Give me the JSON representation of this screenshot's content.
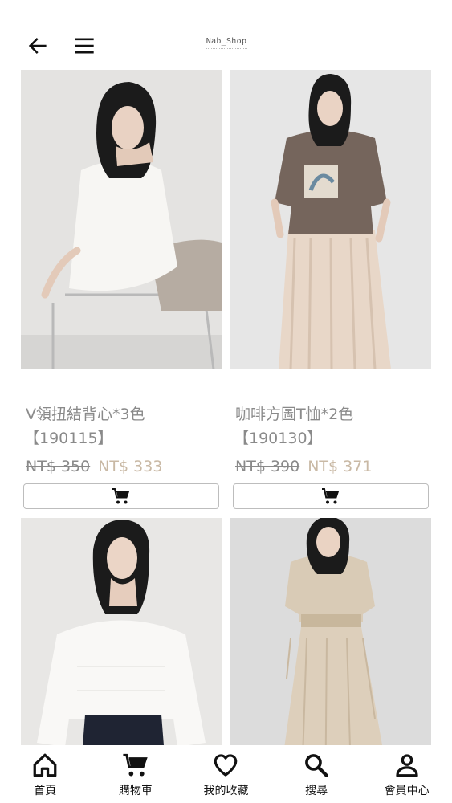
{
  "header": {
    "logo_text": "Nab_Shop",
    "back_icon": "arrow-left-icon",
    "menu_icon": "hamburger-menu-icon"
  },
  "products": [
    {
      "image": "model in white sleeveless top, beige trousers, seated on clear chair",
      "name": "V領扭結背心*3色",
      "code": "【190115】",
      "original_price": "NT$ 350",
      "sale_price": "NT$ 333",
      "cart_icon": "shopping-cart-icon"
    },
    {
      "image": "model in brown graphic tee and pleated beige wide-leg pants",
      "name": "咖啡方圖T恤*2色",
      "code": "【190130】",
      "original_price": "NT$ 390",
      "sale_price": "NT$ 371",
      "cart_icon": "shopping-cart-icon"
    },
    {
      "image": "model in white sheer blouse and dark denim jeans"
    },
    {
      "image": "model in beige patterned short-sleeve dress with waist tie"
    }
  ],
  "bottom_nav": [
    {
      "label": "首頁",
      "icon": "home-icon"
    },
    {
      "label": "購物車",
      "icon": "shopping-cart-icon"
    },
    {
      "label": "我的收藏",
      "icon": "heart-icon"
    },
    {
      "label": "搜尋",
      "icon": "search-icon"
    },
    {
      "label": "會員中心",
      "icon": "user-icon"
    }
  ],
  "colors": {
    "text_gray": "#8a8a8a",
    "sale_price": "#c9b9a5",
    "icon_dark": "#111111"
  }
}
